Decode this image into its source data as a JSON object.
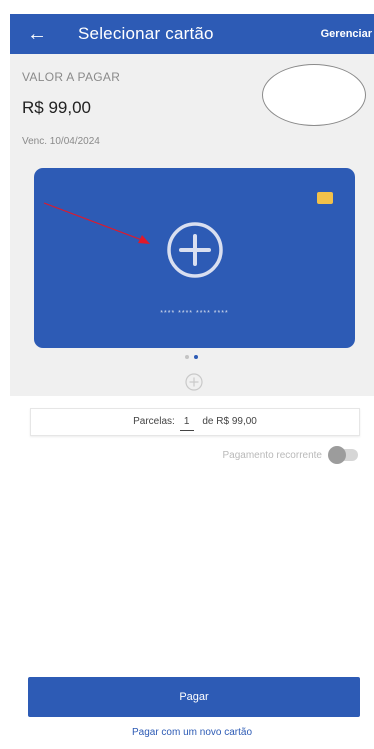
{
  "header": {
    "title": "Selecionar cartão",
    "action_label": "Gerenciar",
    "back_icon": "arrow-left-icon"
  },
  "payment": {
    "amount_label": "VALOR A PAGAR",
    "amount_value": "R$ 99,00",
    "due_date": "Venc. 10/04/2024"
  },
  "card": {
    "masked_number": "**** **** **** ****",
    "add_icon": "plus-circle-icon",
    "chip_icon": "card-chip-icon",
    "carousel_pages": 2,
    "carousel_active_index": 1
  },
  "installments": {
    "label": "Parcelas:",
    "quantity": "1",
    "amount_text": "de R$ 99,00"
  },
  "recurring": {
    "label": "Pagamento recorrente",
    "enabled": false
  },
  "actions": {
    "pay_label": "Pagar",
    "new_card_label": "Pagar com um novo cartão"
  },
  "colors": {
    "primary": "#2d5bb5",
    "background_panel": "#f0f0f0",
    "chip": "#f2c14a",
    "annotation_arrow": "#e0192a"
  }
}
